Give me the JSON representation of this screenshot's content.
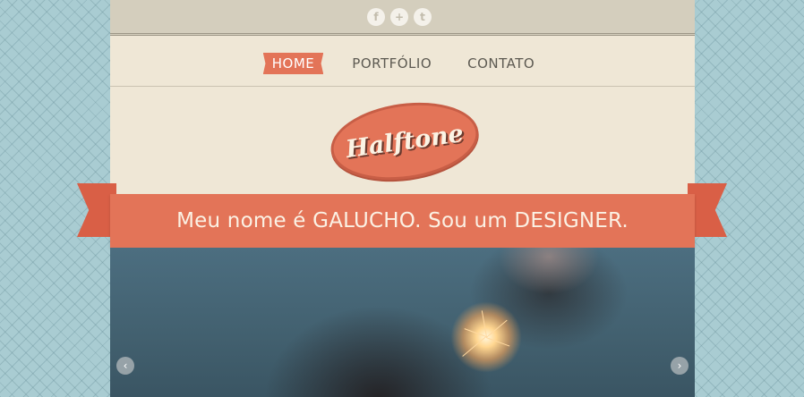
{
  "social": [
    {
      "name": "facebook-icon",
      "glyph": "f"
    },
    {
      "name": "google-plus-icon",
      "glyph": "+"
    },
    {
      "name": "twitter-icon",
      "glyph": "t"
    }
  ],
  "nav": {
    "home": "HOME",
    "portfolio": "PORTFÓLIO",
    "contact": "CONTATO"
  },
  "logo": {
    "text": "Halftone"
  },
  "banner": {
    "tagline": "Meu nome é GALUCHO. Sou um DESIGNER."
  },
  "slider": {
    "prev_glyph": "‹",
    "next_glyph": "›"
  },
  "colors": {
    "accent": "#e37458",
    "background": "#a9ccd2",
    "page": "#efe7d6"
  }
}
